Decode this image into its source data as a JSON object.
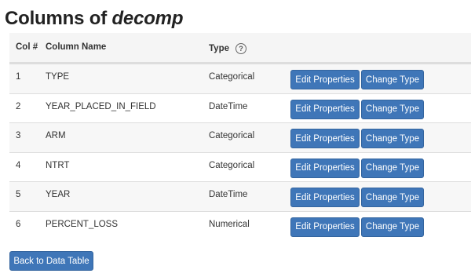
{
  "page": {
    "title_prefix": "Columns of ",
    "title_name": "decomp"
  },
  "table": {
    "headers": {
      "num": "Col #",
      "name": "Column Name",
      "type": "Type",
      "help_icon": "?"
    },
    "rows": [
      {
        "num": "1",
        "name": "TYPE",
        "type": "Categorical",
        "edit_label": "Edit Properties",
        "change_label": "Change Type"
      },
      {
        "num": "2",
        "name": "YEAR_PLACED_IN_FIELD",
        "type": "DateTime",
        "edit_label": "Edit Properties",
        "change_label": "Change Type"
      },
      {
        "num": "3",
        "name": "ARM",
        "type": "Categorical",
        "edit_label": "Edit Properties",
        "change_label": "Change Type"
      },
      {
        "num": "4",
        "name": "NTRT",
        "type": "Categorical",
        "edit_label": "Edit Properties",
        "change_label": "Change Type"
      },
      {
        "num": "5",
        "name": "YEAR",
        "type": "DateTime",
        "edit_label": "Edit Properties",
        "change_label": "Change Type"
      },
      {
        "num": "6",
        "name": "PERCENT_LOSS",
        "type": "Numerical",
        "edit_label": "Edit Properties",
        "change_label": "Change Type"
      }
    ]
  },
  "footer": {
    "back_label": "Back to Data Table"
  },
  "colors": {
    "button_bg": "#3f76b8",
    "row_stripe": "#f7f7f7"
  },
  "icons": {
    "help": "question-circle-icon"
  }
}
